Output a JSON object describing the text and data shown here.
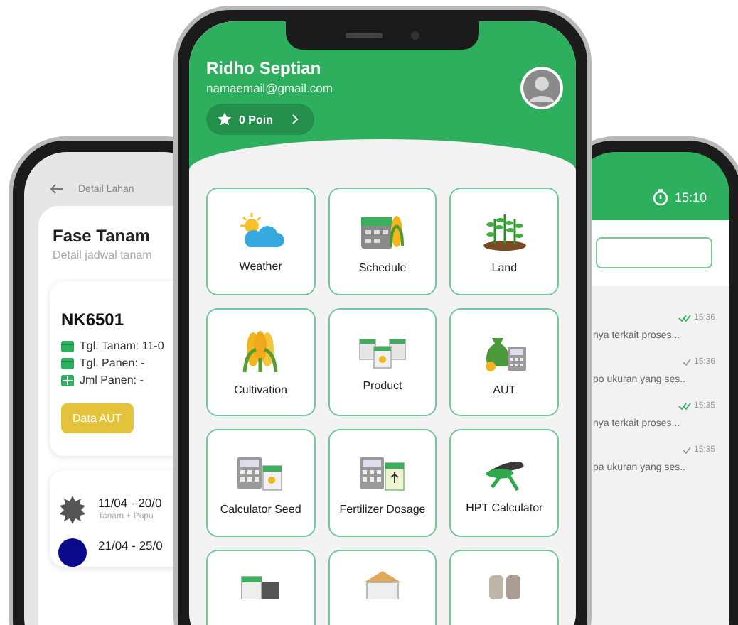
{
  "left_phone": {
    "header": "Detail Lahan",
    "title": "Fase Tanam",
    "subtitle": "Detail jadwal tanam",
    "card": {
      "code": "NK6501",
      "rows": [
        {
          "kind": "calendar",
          "text": "Tgl. Tanam: 11-0"
        },
        {
          "kind": "calendar",
          "text": "Tgl. Panen: -"
        },
        {
          "kind": "grid",
          "text": "Jml Panen: -"
        }
      ],
      "button": "Data AUT"
    },
    "timeline": [
      {
        "kind": "gear",
        "date": "11/04 - 20/0",
        "note": "Tanam + Pupu"
      },
      {
        "kind": "dot",
        "date": "21/04 - 25/0"
      }
    ]
  },
  "profile": {
    "name": "Ridho Septian",
    "email": "namaemail@gmail.com",
    "points": "0 Poin"
  },
  "menu": [
    {
      "kind": "labeled",
      "label": "Weather"
    },
    {
      "kind": "labeled",
      "label": "Schedule"
    },
    {
      "kind": "labeled",
      "label": "Land"
    },
    {
      "kind": "labeled",
      "label": "Cultivation"
    },
    {
      "kind": "labeled",
      "label": "Product"
    },
    {
      "kind": "labeled",
      "label": "AUT"
    },
    {
      "kind": "labeled",
      "label": "Calculator Seed"
    },
    {
      "kind": "labeled",
      "label": "Fertilizer Dosage"
    },
    {
      "kind": "labeled",
      "label": "HPT Calculator"
    },
    {
      "kind": "cut"
    },
    {
      "kind": "cut"
    },
    {
      "kind": "cut"
    }
  ],
  "right_phone": {
    "time": "15:10",
    "messages": [
      {
        "time": "15:36",
        "read": true,
        "preview": "nya terkait proses..."
      },
      {
        "time": "15:36",
        "read": false,
        "preview": "po ukuran yang ses.."
      },
      {
        "time": "15:35",
        "read": true,
        "preview": "nya terkait proses..."
      },
      {
        "time": "15:35",
        "read": false,
        "preview": "pa ukuran yang ses.."
      }
    ]
  }
}
